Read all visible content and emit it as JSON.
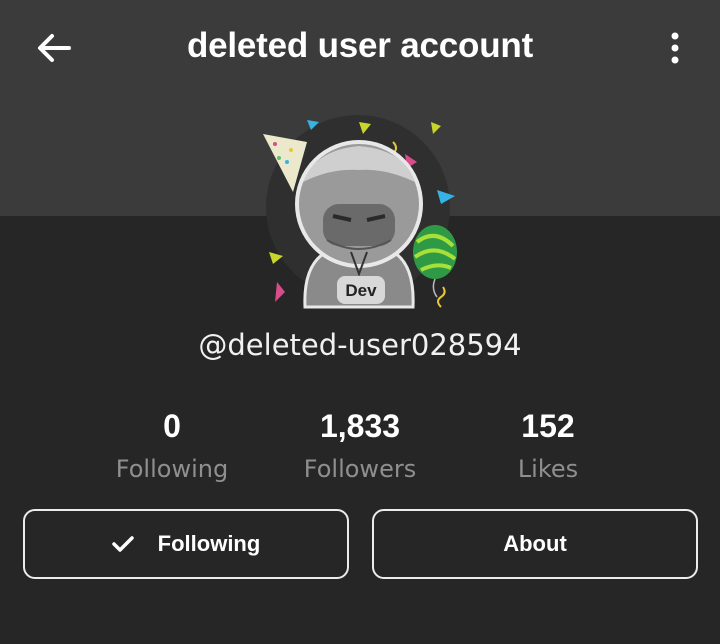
{
  "header": {
    "title": "deleted user account",
    "back_icon": "arrow-left-icon",
    "menu_icon": "more-vertical-icon"
  },
  "profile": {
    "handle": "@deleted-user028594",
    "badge": "Dev"
  },
  "stats": [
    {
      "value": "0",
      "label": "Following"
    },
    {
      "value": "1,833",
      "label": "Followers"
    },
    {
      "value": "152",
      "label": "Likes"
    }
  ],
  "actions": {
    "following_label": "Following",
    "following_icon": "check-icon",
    "about_label": "About"
  },
  "colors": {
    "background": "#262626",
    "header": "#3b3b3b",
    "muted_text": "#8f8f8f",
    "button_border": "#ececec"
  }
}
